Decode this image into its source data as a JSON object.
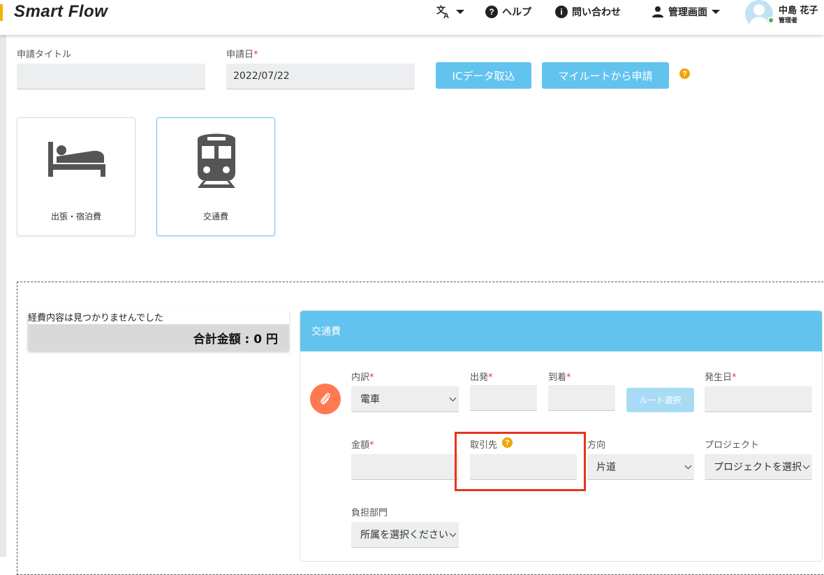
{
  "header": {
    "logo": "Smart Flow",
    "language_icon": "translate-icon",
    "help_label": "ヘルプ",
    "contact_label": "問い合わせ",
    "admin_label": "管理画面",
    "user_name": "中島 花子",
    "user_role": "管理者"
  },
  "form": {
    "title_label": "申請タイトル",
    "title_value": "",
    "date_label": "申請日",
    "date_value": "2022/07/22",
    "ic_import_label": "ICデータ取込",
    "myroute_label": "マイルートから申請"
  },
  "categories": [
    {
      "label": "出張・宿泊費",
      "icon": "bed-icon"
    },
    {
      "label": "交通費",
      "icon": "train-icon"
    }
  ],
  "summary": {
    "message": "経費内容は見つかりませんでした",
    "total": "合計金額 : 0 円"
  },
  "panel": {
    "title": "交通費",
    "breakdown_label": "内訳",
    "breakdown_value": "電車",
    "departure_label": "出発",
    "arrival_label": "到着",
    "route_button": "ルート選択",
    "date_label": "発生日",
    "amount_label": "金額",
    "client_label": "取引先",
    "direction_label": "方向",
    "direction_value": "片道",
    "project_label": "プロジェクト",
    "project_value": "プロジェクトを選択",
    "dept_label": "負担部門",
    "dept_value": "所属を選択ください"
  },
  "colors": {
    "accent": "#63c3ef",
    "attach": "#ff7a50",
    "required": "#e53935",
    "highlight": "#e8341c",
    "help": "#f0a500"
  }
}
